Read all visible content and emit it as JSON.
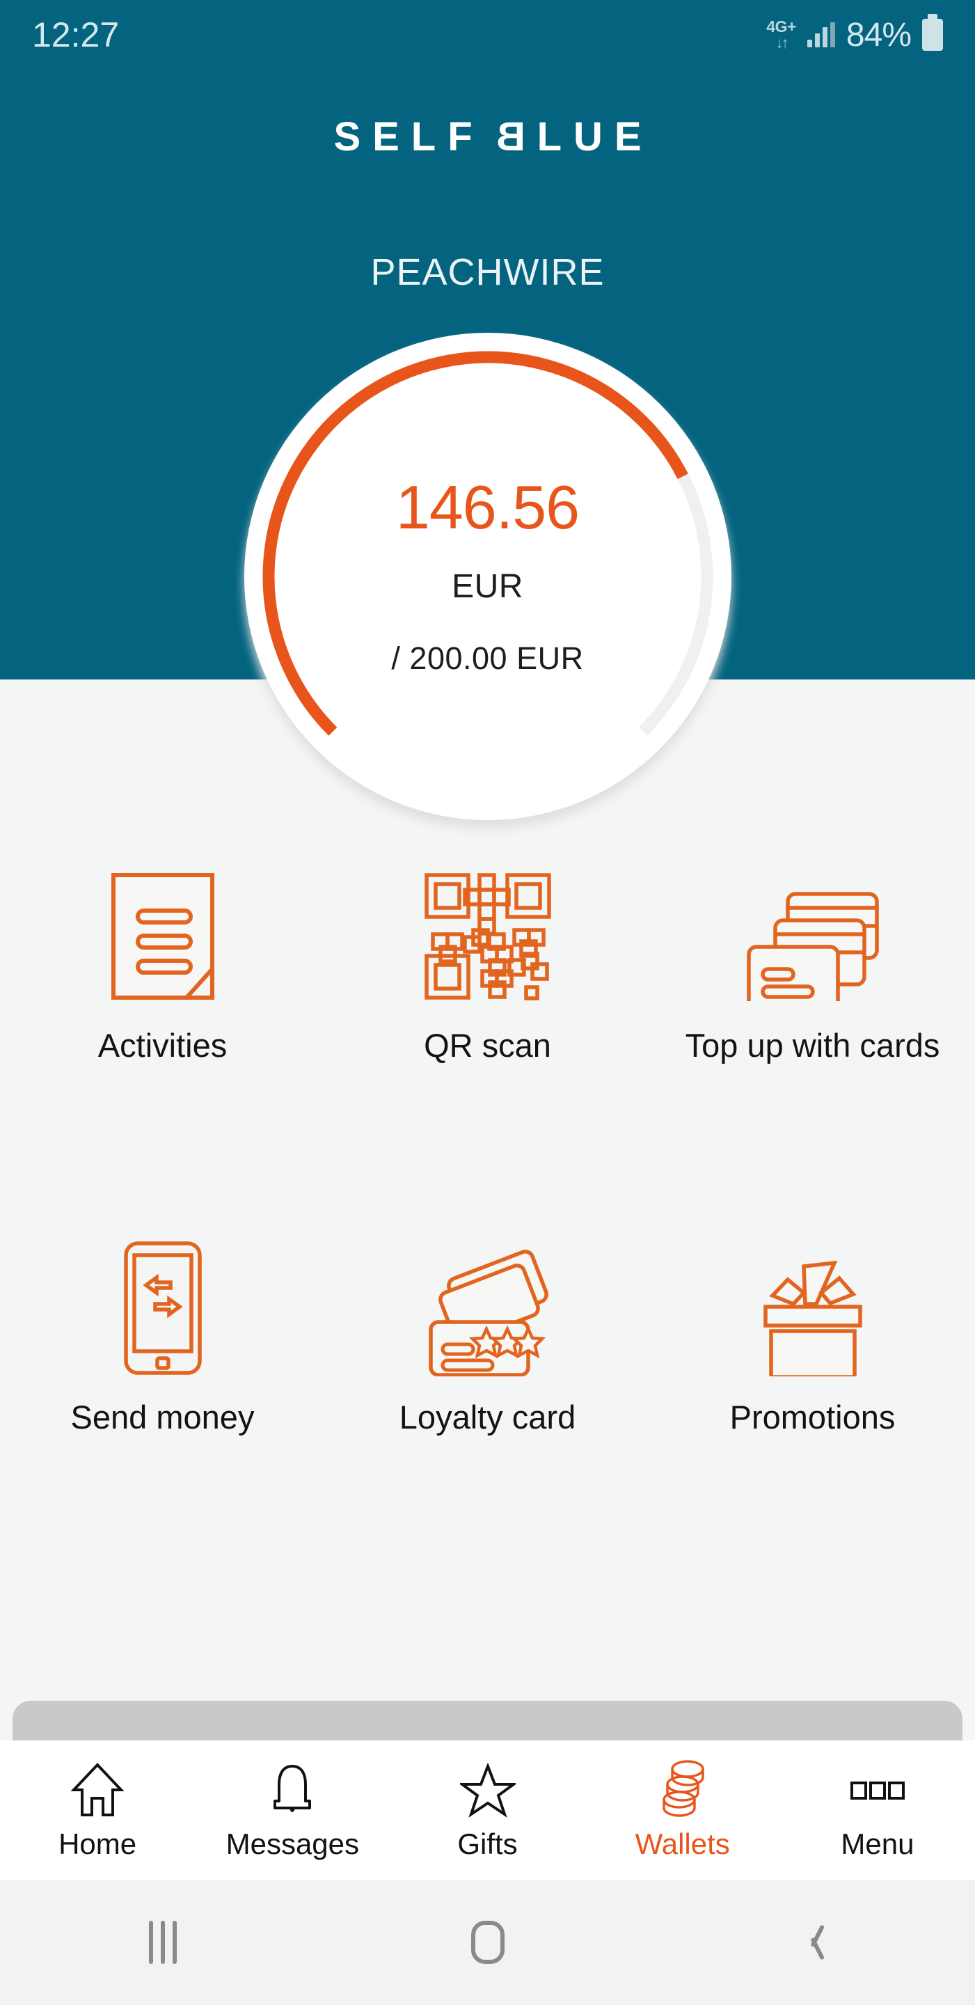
{
  "status_bar": {
    "time": "12:27",
    "network_label": "4G+",
    "network_arrows": "↓↑",
    "battery_percent": "84%",
    "signal_icon": "signal-bars-icon",
    "battery_icon": "battery-icon"
  },
  "header": {
    "brand_part1": "SELF",
    "brand_flip": "B",
    "brand_part2": "LUE",
    "brand_full": "SELFBLUE",
    "wallet_name": "PEACHWIRE",
    "teal": "#046480"
  },
  "balance_gauge": {
    "amount": "146.56",
    "currency": "EUR",
    "limit_text": "/ 200.00 EUR",
    "accent": "#e8551a",
    "track": "#f0f0f0",
    "value": 146.56,
    "max": 200.0,
    "percent": 73
  },
  "shortcuts": [
    {
      "id": "activities",
      "label": "Activities",
      "icon": "document-lines-icon"
    },
    {
      "id": "qr-scan",
      "label": "QR scan",
      "icon": "qr-code-icon"
    },
    {
      "id": "top-up-cards",
      "label": "Top up with cards",
      "icon": "stacked-cards-icon"
    },
    {
      "id": "send-money",
      "label": "Send money",
      "icon": "phone-transfer-icon"
    },
    {
      "id": "loyalty-card",
      "label": "Loyalty card",
      "icon": "loyalty-cards-stars-icon"
    },
    {
      "id": "promotions",
      "label": "Promotions",
      "icon": "gift-box-icon"
    }
  ],
  "bottom_nav": {
    "active": "Wallets",
    "items": [
      {
        "id": "home",
        "label": "Home",
        "icon": "house-icon",
        "active": false
      },
      {
        "id": "messages",
        "label": "Messages",
        "icon": "bell-icon",
        "active": false
      },
      {
        "id": "gifts",
        "label": "Gifts",
        "icon": "star-icon",
        "active": false
      },
      {
        "id": "wallets",
        "label": "Wallets",
        "icon": "stacked-coins-icon",
        "active": true
      },
      {
        "id": "menu",
        "label": "Menu",
        "icon": "three-squares-icon",
        "active": false
      }
    ]
  },
  "android_nav": {
    "recents_icon": "recents-icon",
    "home_icon": "home-square-icon",
    "back_icon": "back-chevron-icon"
  }
}
